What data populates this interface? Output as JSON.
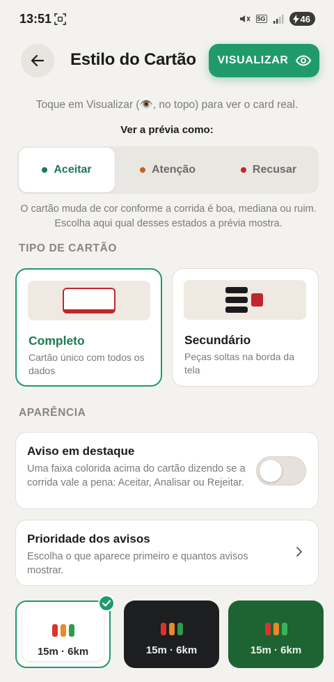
{
  "status_bar": {
    "time": "13:51",
    "network": "5G",
    "battery": "46"
  },
  "header": {
    "title": "Estilo do Cartão",
    "preview_button": "VISUALIZAR"
  },
  "hint": "Toque em Visualizar (👁️, no topo) para ver o card real.",
  "preview_as_label": "Ver a prévia como:",
  "preview_states": [
    {
      "label": "Aceitar",
      "color": "#1d7a52",
      "active": true
    },
    {
      "label": "Atenção",
      "color": "#c0651d",
      "active": false
    },
    {
      "label": "Recusar",
      "color": "#c0262d",
      "active": false
    }
  ],
  "preview_description": "O cartão muda de cor conforme a corrida é boa, mediana ou ruim. Escolha aqui qual desses estados a prévia mostra.",
  "card_type": {
    "section_title": "TIPO DE CARTÃO",
    "options": [
      {
        "name": "Completo",
        "description": "Cartão único com todos os dados",
        "selected": true
      },
      {
        "name": "Secundário",
        "description": "Peças soltas na borda da tela",
        "selected": false
      }
    ]
  },
  "appearance": {
    "section_title": "APARÊNCIA",
    "highlight_warning": {
      "title": "Aviso em destaque",
      "description": "Uma faixa colorida acima do cartão dizendo se a corrida vale a pena: Aceitar, Analisar ou Rejeitar.",
      "enabled": false
    },
    "warning_priority": {
      "title": "Prioridade dos avisos",
      "description": "Escolha o que aparece primeiro e quantos avisos mostrar."
    }
  },
  "style_tiles": [
    {
      "label": "15m · 6km",
      "theme": "light",
      "selected": true
    },
    {
      "label": "15m · 6km",
      "theme": "dark",
      "selected": false
    },
    {
      "label": "15m · 6km",
      "theme": "green",
      "selected": false
    }
  ],
  "colors": {
    "accent": "#1f9b6a",
    "accent_text": "#1d7a52",
    "background": "#f3f2ef"
  }
}
